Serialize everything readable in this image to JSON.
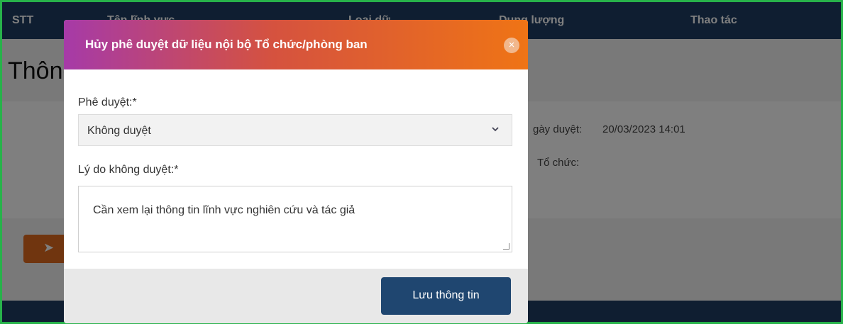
{
  "table_header": {
    "col_stt": "STT",
    "col_name": "Tên lĩnh vực",
    "col_type": "Loại dữ",
    "col_count": "Dung lượng",
    "col_actions": "Thao tác"
  },
  "background": {
    "section_title": "Thông",
    "approve_date_label": "gày duyệt:",
    "approve_date_value": "20/03/2023 14:01",
    "org_label": "Tổ chức:",
    "submit_glyph": "➤"
  },
  "modal": {
    "title": "Hủy phê duyệt dữ liệu nội bộ Tổ chức/phòng ban",
    "close_glyph": "×",
    "approval_label": "Phê duyệt:*",
    "approval_value": "Không duyệt",
    "reason_label": "Lý do không duyệt:*",
    "reason_value": "Cần xem lại thông tin lĩnh vực nghiên cứu và tác giả",
    "save_label": "Lưu thông tin"
  }
}
